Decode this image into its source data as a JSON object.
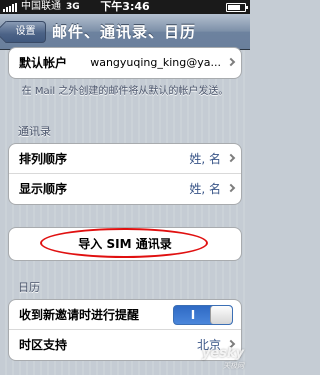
{
  "status_bar": {
    "carrier": "中国联通",
    "network": "3G",
    "time": "下午3:46",
    "battery_level": 0.75
  },
  "nav": {
    "back_label": "设置",
    "title": "邮件、通讯录、日历"
  },
  "mail": {
    "default_account_label": "默认帐户",
    "default_account_value": "wangyuqing_king@ya...",
    "note": "在 Mail 之外创建的邮件将从默认的帐户发送。"
  },
  "contacts": {
    "header": "通讯录",
    "sort_order_label": "排列顺序",
    "sort_order_value": "姓, 名",
    "display_order_label": "显示顺序",
    "display_order_value": "姓, 名",
    "import_sim_label": "导入 SIM 通讯录"
  },
  "calendar": {
    "header": "日历",
    "invite_alert_label": "收到新邀请时进行提醒",
    "invite_alert_toggle": "I",
    "invite_alert_on": true,
    "timezone_label": "时区支持",
    "timezone_value": "北京"
  },
  "watermark": {
    "brand": "yesky",
    "sub": "天极网"
  },
  "colors": {
    "annotation_ellipse": "#e01010",
    "toggle_on": "#2f6ac4",
    "value_text": "#385487"
  }
}
